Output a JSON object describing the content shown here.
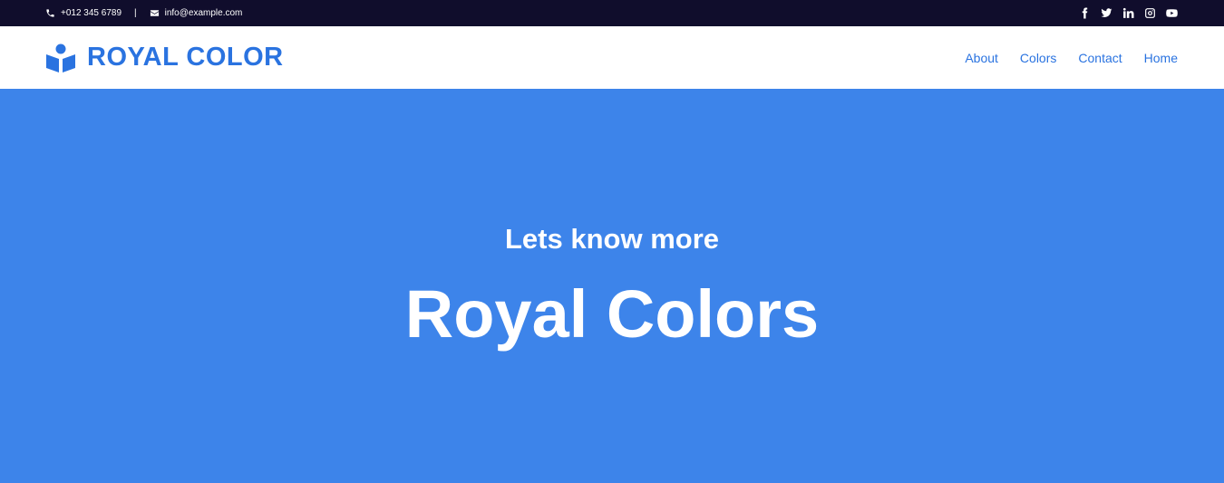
{
  "topbar": {
    "phone": "+012 345 6789",
    "separator": "|",
    "email": "info@example.com",
    "social": [
      "facebook-icon",
      "twitter-icon",
      "linkedin-icon",
      "instagram-icon",
      "youtube-icon"
    ]
  },
  "navbar": {
    "brand": "ROYAL COLOR",
    "links": [
      "About",
      "Colors",
      "Contact",
      "Home"
    ]
  },
  "hero": {
    "subtitle": "Lets know more",
    "title": "Royal Colors"
  },
  "colors": {
    "topbar_bg": "#100d2c",
    "brand": "#2a73e0",
    "hero_bg": "#3d84ea"
  }
}
